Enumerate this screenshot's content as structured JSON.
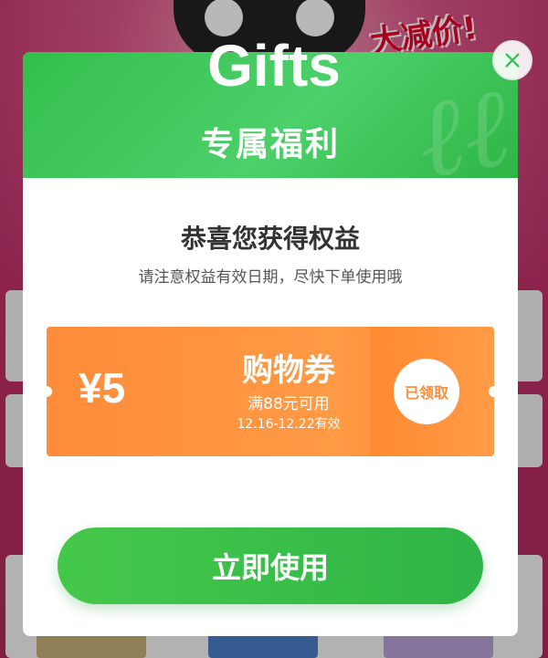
{
  "modal": {
    "title": "Gifts",
    "subtitle": "专属福利",
    "congrats_title": "恭喜您获得权益",
    "congrats_subtitle": "请注意权益有效日期，尽快下单使用哦"
  },
  "coupon": {
    "amount": "¥5",
    "name": "购物券",
    "condition": "满88元可用",
    "validity": "12.16-12.22有效",
    "status": "已领取"
  },
  "actions": {
    "use_now": "立即使用"
  },
  "background": {
    "promo_text": "大减价!"
  },
  "colors": {
    "green": "#33bf4c",
    "orange": "#ff8c3a",
    "pink_bg": "#c5306a"
  },
  "icons": {
    "close": "close-icon"
  }
}
